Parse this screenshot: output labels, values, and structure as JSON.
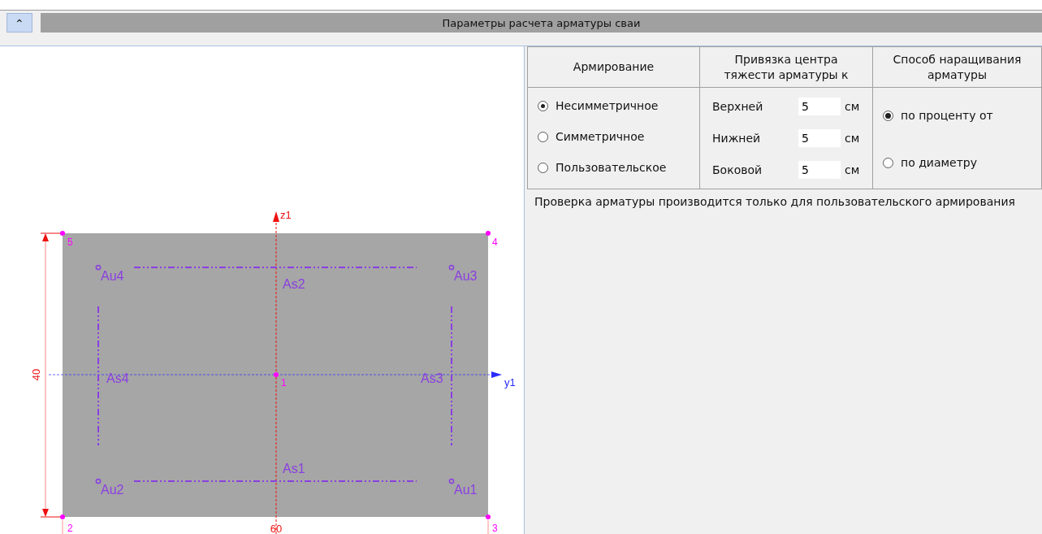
{
  "header": {
    "collapse_icon": "⌃",
    "title": "Параметры расчета арматуры сваи"
  },
  "drawing": {
    "z_axis": "z1",
    "y_axis": "y1",
    "height_dim": "40",
    "width_dim": "60",
    "nodes": [
      "5",
      "4",
      "1",
      "2",
      "3"
    ],
    "corner_bars": [
      "Au4",
      "Au3",
      "Au2",
      "Au1"
    ],
    "side_bars": [
      "As2",
      "As4",
      "As3",
      "As1"
    ]
  },
  "table": {
    "columns": [
      "Армирование",
      "Привязка центра тяжести арматуры к",
      "Способ наращивания арматуры"
    ],
    "reinforcement": [
      {
        "label": "Несимметричное",
        "selected": true
      },
      {
        "label": "Симметричное",
        "selected": false
      },
      {
        "label": "Пользовательское",
        "selected": false
      }
    ],
    "offsets": [
      {
        "label": "Верхней",
        "value": "5",
        "unit": "см"
      },
      {
        "label": "Нижней",
        "value": "5",
        "unit": "см"
      },
      {
        "label": "Боковой",
        "value": "5",
        "unit": "см"
      }
    ],
    "method": [
      {
        "label": "по проценту от",
        "selected": true
      },
      {
        "label": "по диаметру",
        "selected": false
      }
    ]
  },
  "note": "Проверка арматуры производится только для пользовательского армирования"
}
